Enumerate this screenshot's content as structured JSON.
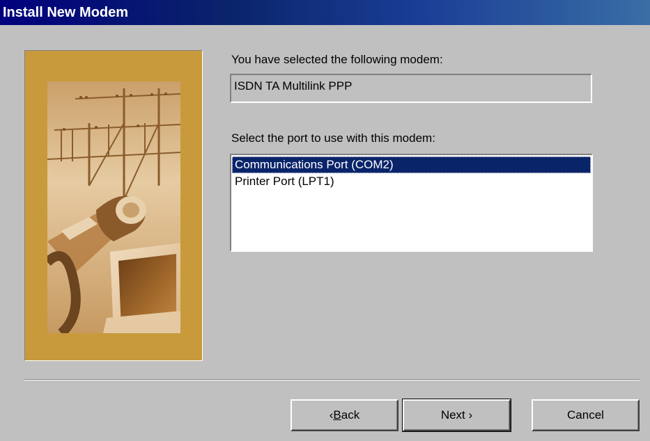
{
  "window": {
    "title": "Install New Modem"
  },
  "modem": {
    "selected_label": "You have selected the following modem:",
    "selected_value": "ISDN TA Multilink PPP"
  },
  "port": {
    "label": "Select the port to use with this modem:",
    "options": [
      "Communications Port (COM2)",
      "Printer Port (LPT1)"
    ],
    "selected_index": 0
  },
  "buttons": {
    "back_prefix": "‹ ",
    "back_accel": "B",
    "back_rest": "ack",
    "next": "Next ›",
    "cancel": "Cancel"
  },
  "colors": {
    "titlebar_start": "#00007e",
    "panel": "#c89a3c",
    "selection": "#0a246a",
    "dialog_face": "#c0c0c0"
  }
}
